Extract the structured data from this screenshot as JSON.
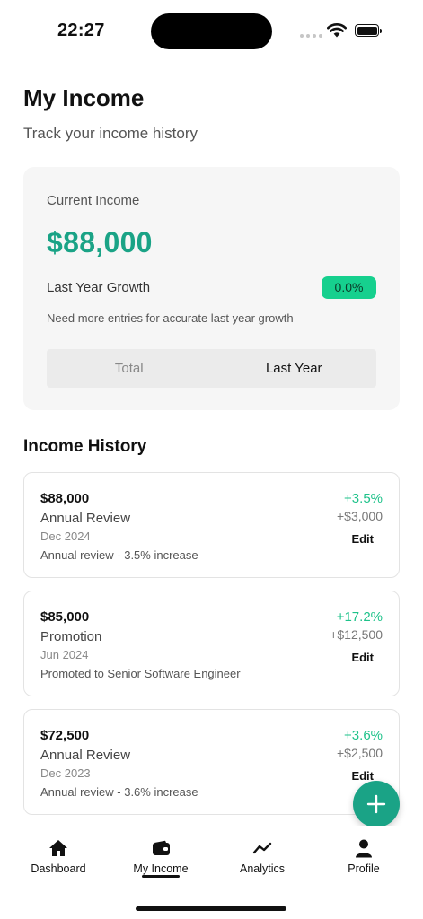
{
  "status_bar": {
    "time": "22:27"
  },
  "header": {
    "title": "My Income",
    "subtitle": "Track your income history"
  },
  "summary": {
    "current_income_label": "Current Income",
    "current_income_value": "$88,000",
    "growth_label": "Last Year Growth",
    "growth_badge": "0.0%",
    "growth_note": "Need more entries for accurate last year growth",
    "segments": [
      {
        "label": "Total",
        "selected": false
      },
      {
        "label": "Last Year",
        "selected": true
      }
    ]
  },
  "history": {
    "title": "Income History",
    "entries": [
      {
        "amount": "$88,000",
        "type": "Annual Review",
        "date": "Dec 2024",
        "description": "Annual review - 3.5% increase",
        "percent": "+3.5%",
        "difference": "+$3,000",
        "edit_label": "Edit"
      },
      {
        "amount": "$85,000",
        "type": "Promotion",
        "date": "Jun 2024",
        "description": "Promoted to Senior Software Engineer",
        "percent": "+17.2%",
        "difference": "+$12,500",
        "edit_label": "Edit"
      },
      {
        "amount": "$72,500",
        "type": "Annual Review",
        "date": "Dec 2023",
        "description": "Annual review - 3.6% increase",
        "percent": "+3.6%",
        "difference": "+$2,500",
        "edit_label": "Edit"
      }
    ]
  },
  "fab": {
    "icon": "plus-icon"
  },
  "tab_bar": {
    "active": "My Income",
    "tabs": [
      {
        "label": "Dashboard",
        "icon": "home-icon"
      },
      {
        "label": "My Income",
        "icon": "wallet-icon"
      },
      {
        "label": "Analytics",
        "icon": "trend-line-icon"
      },
      {
        "label": "Profile",
        "icon": "person-icon"
      }
    ]
  },
  "colors": {
    "accent": "#1aa386",
    "positive": "#1ec28a",
    "badge": "#16d08e"
  }
}
